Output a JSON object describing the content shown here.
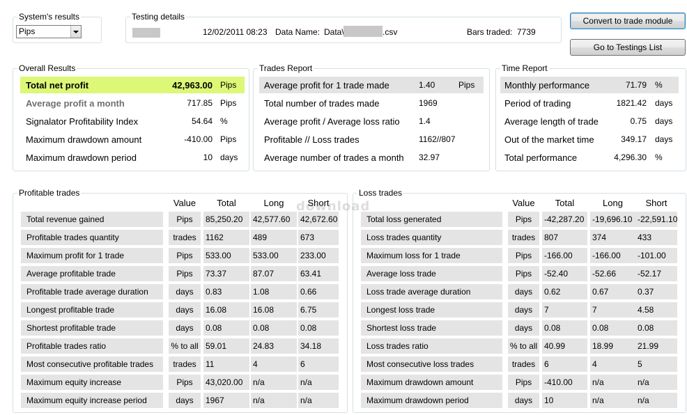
{
  "systems_results": {
    "title": "System's results",
    "selected": "Pips"
  },
  "testing_details": {
    "title": "Testing details",
    "date": "12/02/2011 08:23",
    "data_name_label": "Data Name:",
    "data_name_prefix": "Data\\",
    "data_name_suffix": ".csv",
    "bars_traded_label": "Bars traded:",
    "bars_traded_value": "7739"
  },
  "buttons": {
    "convert": "Convert to trade module",
    "go_to_testings": "Go to Testings List"
  },
  "overall_results": {
    "title": "Overall Results",
    "rows": [
      {
        "label": "Total net profit",
        "value": "42,963.00",
        "unit": "Pips"
      },
      {
        "label": "Average profit a month",
        "value": "717.85",
        "unit": "Pips"
      },
      {
        "label": "Signalator Profitability Index",
        "value": "54.64",
        "unit": "%"
      },
      {
        "label": "Maximum drawdown amount",
        "value": "-410.00",
        "unit": "Pips"
      },
      {
        "label": "Maximum drawdown period",
        "value": "10",
        "unit": "days"
      }
    ]
  },
  "trades_report": {
    "title": "Trades Report",
    "rows": [
      {
        "label": "Average profit for 1 trade made",
        "value": "1.40",
        "unit": "Pips"
      },
      {
        "label": "Total number of trades made",
        "value": "1969",
        "unit": ""
      },
      {
        "label": "Average profit / Average loss ratio",
        "value": "1.4",
        "unit": ""
      },
      {
        "label": "Profitable // Loss trades",
        "value": "1162//807",
        "unit": ""
      },
      {
        "label": "Average number of trades a month",
        "value": "32.97",
        "unit": ""
      }
    ]
  },
  "time_report": {
    "title": "Time Report",
    "rows": [
      {
        "label": "Monthly performance",
        "value": "71.79",
        "unit": "%"
      },
      {
        "label": "Period of trading",
        "value": "1821.42",
        "unit": "days"
      },
      {
        "label": "Average length of trade",
        "value": "0.75",
        "unit": "days"
      },
      {
        "label": "Out of the market time",
        "value": "349.17",
        "unit": "days"
      },
      {
        "label": "Total performance",
        "value": "4,296.30",
        "unit": "%"
      }
    ]
  },
  "profitable_trades": {
    "title": "Profitable trades",
    "headers": [
      "Value",
      "Total",
      "Long",
      "Short"
    ],
    "rows": [
      {
        "label": "Total revenue gained",
        "unit": "Pips",
        "total": "85,250.20",
        "long": "42,577.60",
        "short": "42,672.60"
      },
      {
        "label": "Profitable trades quantity",
        "unit": "trades",
        "total": "1162",
        "long": "489",
        "short": "673"
      },
      {
        "label": "Maximum profit for 1 trade",
        "unit": "Pips",
        "total": "533.00",
        "long": "533.00",
        "short": "233.00"
      },
      {
        "label": "Average profitable trade",
        "unit": "Pips",
        "total": "73.37",
        "long": "87.07",
        "short": "63.41"
      },
      {
        "label": "Profitable trade average duration",
        "unit": "days",
        "total": "0.83",
        "long": "1.08",
        "short": "0.66"
      },
      {
        "label": "Longest profitable trade",
        "unit": "days",
        "total": "16.08",
        "long": "16.08",
        "short": "6.75"
      },
      {
        "label": "Shortest profitable trade",
        "unit": "days",
        "total": "0.08",
        "long": "0.08",
        "short": "0.08"
      },
      {
        "label": "Profitable trades ratio",
        "unit": "% to all",
        "total": "59.01",
        "long": "24.83",
        "short": "34.18"
      },
      {
        "label": "Most consecutive profitable trades",
        "unit": "trades",
        "total": "11",
        "long": "4",
        "short": "6"
      },
      {
        "label": "Maximum equity increase",
        "unit": "Pips",
        "total": "43,020.00",
        "long": "n/a",
        "short": "n/a"
      },
      {
        "label": "Maximum equity increase period",
        "unit": "days",
        "total": "1967",
        "long": "n/a",
        "short": "n/a"
      }
    ]
  },
  "loss_trades": {
    "title": "Loss trades",
    "headers": [
      "Value",
      "Total",
      "Long",
      "Short"
    ],
    "rows": [
      {
        "label": "Total loss generated",
        "unit": "Pips",
        "total": "-42,287.20",
        "long": "-19,696.10",
        "short": "-22,591.10"
      },
      {
        "label": "Loss trades quantity",
        "unit": "trades",
        "total": "807",
        "long": "374",
        "short": "433"
      },
      {
        "label": "Maximum loss for 1 trade",
        "unit": "Pips",
        "total": "-166.00",
        "long": "-166.00",
        "short": "-101.00"
      },
      {
        "label": "Average loss trade",
        "unit": "Pips",
        "total": "-52.40",
        "long": "-52.66",
        "short": "-52.17"
      },
      {
        "label": "Loss  trade average duration",
        "unit": "days",
        "total": "0.62",
        "long": "0.67",
        "short": "0.37"
      },
      {
        "label": "Longest loss trade",
        "unit": "days",
        "total": "7",
        "long": "7",
        "short": "4.58"
      },
      {
        "label": "Shortest loss trade",
        "unit": "days",
        "total": "0.08",
        "long": "0.08",
        "short": "0.08"
      },
      {
        "label": "Loss trades ratio",
        "unit": "% to all",
        "total": "40.99",
        "long": "18.99",
        "short": "21.99"
      },
      {
        "label": "Most consecutive loss trades",
        "unit": "trades",
        "total": "6",
        "long": "4",
        "short": "5"
      },
      {
        "label": "Maximum drawdown amount",
        "unit": "Pips",
        "total": "-410.00",
        "long": "n/a",
        "short": "n/a"
      },
      {
        "label": "Maximum drawdown period",
        "unit": "days",
        "total": "10",
        "long": "n/a",
        "short": "n/a"
      }
    ]
  },
  "watermark": "download"
}
